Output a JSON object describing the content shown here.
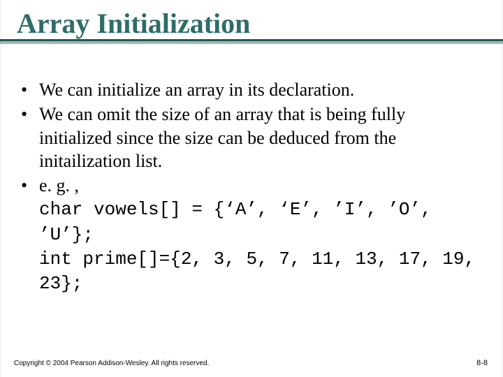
{
  "title": "Array Initialization",
  "bullets": [
    {
      "text": "We can initialize an array in its declaration."
    },
    {
      "text": "We can omit the size of an array that is being fully initialized since the size can be deduced from the initailization list."
    },
    {
      "lead": "e. g. ,",
      "code1": "char vowels[] = {‘A’, ‘E’, ’I’, ’O’, ’U’};",
      "code2": "int prime[]={2, 3, 5, 7, 11, 13, 17, 19, 23};"
    }
  ],
  "footer": "Copyright © 2004 Pearson Addison-Wesley. All rights reserved.",
  "page": "8-8"
}
